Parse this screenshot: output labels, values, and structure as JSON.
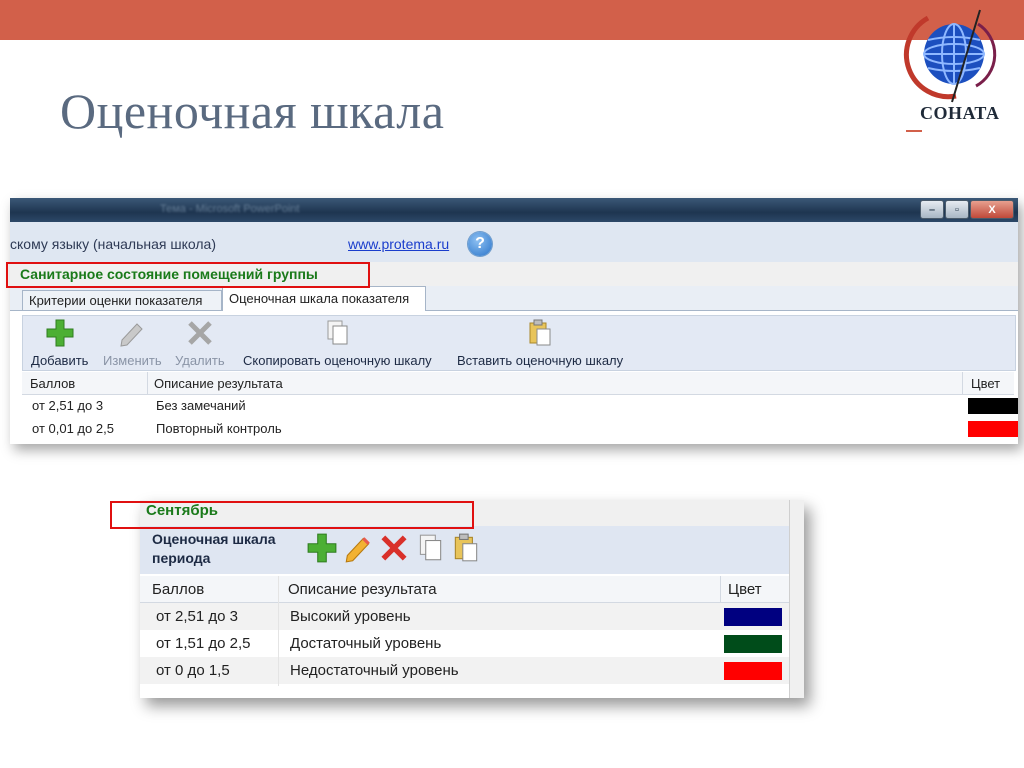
{
  "slide": {
    "title": "Оценочная шкала"
  },
  "logo": {
    "text": "СОНАТА"
  },
  "colors": {
    "topbar": "#d2604a",
    "accent_green": "#1a7a1a",
    "highlight_red": "#e01010"
  },
  "window1": {
    "titlebar_text": "Тема - Microsoft PowerPoint",
    "window_buttons": {
      "minimize": "–",
      "restore": "▫",
      "close": "X"
    },
    "breadcrumb": "скому языку (начальная школа)",
    "site_link": "www.protema.ru",
    "help_label": "?",
    "section_title": "Санитарное состояние помещений группы",
    "tabs": [
      {
        "label": "Критерии оценки показателя"
      },
      {
        "label": "Оценочная шкала показателя"
      }
    ],
    "toolbar": {
      "add": "Добавить",
      "edit": "Изменить",
      "delete": "Удалить",
      "copy": "Скопировать оценочную шкалу",
      "paste": "Вставить оценочную шкалу"
    },
    "columns": {
      "score": "Баллов",
      "desc": "Описание результата",
      "color": "Цвет"
    },
    "rows": [
      {
        "score": "от 2,51 до 3",
        "desc": "Без замечаний",
        "color": "#000000"
      },
      {
        "score": "от 0,01 до 2,5",
        "desc": "Повторный контроль",
        "color": "#ff0000"
      }
    ]
  },
  "window2": {
    "section_title": "Сентябрь",
    "label_line1": "Оценочная шкала",
    "label_line2": "периода",
    "columns": {
      "score": "Баллов",
      "desc": "Описание результата",
      "color": "Цвет"
    },
    "rows": [
      {
        "score": "от 2,51 до 3",
        "desc": "Высокий уровень",
        "color": "#000080"
      },
      {
        "score": "от 1,51 до 2,5",
        "desc": "Достаточный уровень",
        "color": "#004c1a"
      },
      {
        "score": "от 0 до 1,5",
        "desc": "Недостаточный уровень",
        "color": "#ff0000"
      }
    ]
  }
}
